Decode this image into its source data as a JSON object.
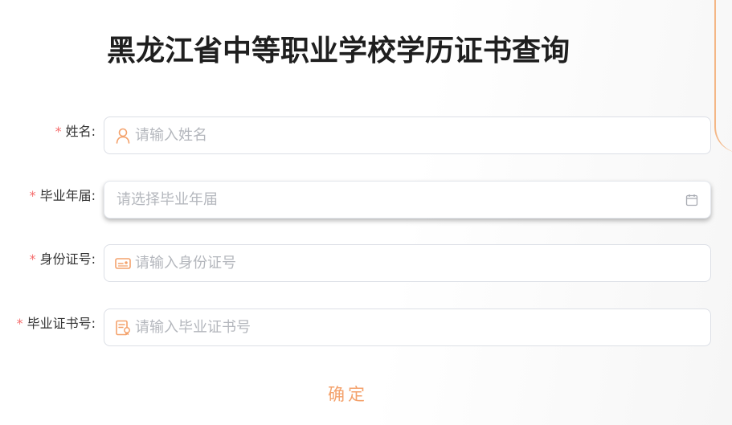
{
  "page": {
    "title": "黑龙江省中等职业学校学历证书查询"
  },
  "form": {
    "required_mark": "*",
    "fields": [
      {
        "label": "姓名:",
        "placeholder": "请输入姓名",
        "value": "",
        "icon": "user-icon"
      },
      {
        "label": "毕业年届:",
        "placeholder": "请选择毕业年届",
        "value": "",
        "icon": "calendar-icon"
      },
      {
        "label": "身份证号:",
        "placeholder": "请输入身份证号",
        "value": "",
        "icon": "id-card-icon"
      },
      {
        "label": "毕业证书号:",
        "placeholder": "请输入毕业证书号",
        "value": "",
        "icon": "certificate-icon"
      }
    ],
    "submit_label": "确定"
  },
  "colors": {
    "accent": "#f4a26c",
    "required": "#f56c6c",
    "title": "#1f1f1f",
    "placeholder": "#b4b7bd",
    "border": "#dcdfe6"
  }
}
